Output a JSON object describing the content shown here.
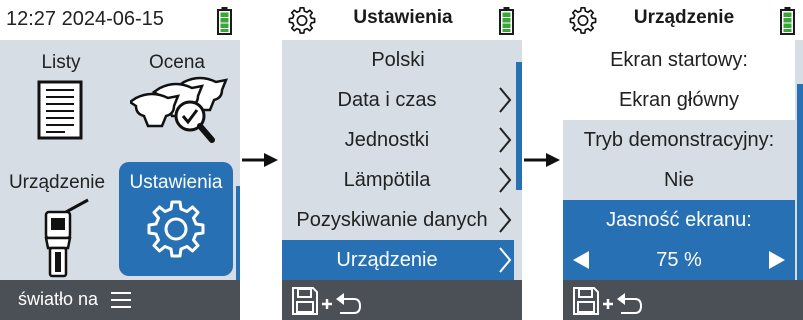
{
  "screen1": {
    "time": "12:27",
    "date": "2024-06-15",
    "tiles": [
      {
        "label": "Listy"
      },
      {
        "label": "Ocena"
      },
      {
        "label": "Urządzenie"
      },
      {
        "label": "Ustawienia"
      }
    ],
    "footer_label": "światło na"
  },
  "screen2": {
    "title": "Ustawienia",
    "items": [
      {
        "label": "Polski"
      },
      {
        "label": "Data i czas"
      },
      {
        "label": "Jednostki"
      },
      {
        "label": "Lämpötila"
      },
      {
        "label": "Pozyskiwanie danych"
      },
      {
        "label": "Urządzenie"
      }
    ]
  },
  "screen3": {
    "title": "Urządzenie",
    "rows": [
      {
        "label": "Ekran startowy:"
      },
      {
        "label": "Ekran główny"
      },
      {
        "label": "Tryb demonstracyjny:"
      },
      {
        "label": "Nie"
      },
      {
        "label": "Jasność ekranu:"
      },
      {
        "label": "75 %"
      }
    ]
  },
  "colors": {
    "accent": "#2670b3",
    "panel": "#d6dde5",
    "footer": "#4b4f56",
    "battery": "#3aa637"
  },
  "icons": [
    "gear-icon",
    "battery-icon",
    "document-icon",
    "cows-magnifier-icon",
    "device-icon",
    "menu-icon",
    "save-icon",
    "back-arrow-icon",
    "chevron-right-icon",
    "arrow-left-icon",
    "arrow-right-icon"
  ]
}
